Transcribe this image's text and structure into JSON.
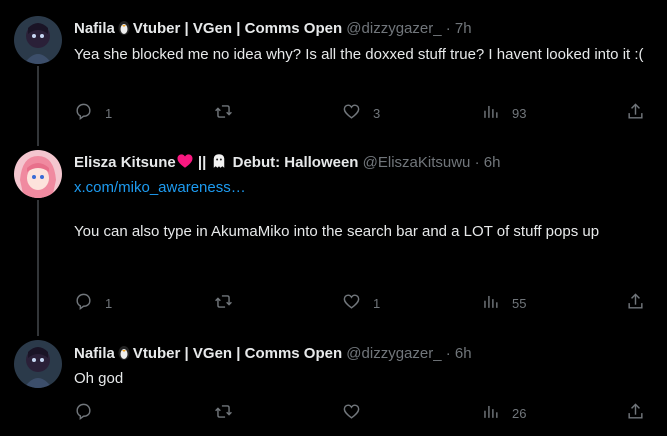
{
  "tweets": [
    {
      "name": "Nafila",
      "name_emoji": "penguin",
      "name_rest": "Vtuber | VGen | Comms Open",
      "handle": "@dizzygazer_",
      "sep": "·",
      "time": "7h",
      "text": "Yea she blocked me no idea why? Is all the doxxed stuff true? I havent looked into it :(",
      "stats": {
        "replies": "1",
        "retweets": "",
        "likes": "3",
        "views": "93"
      }
    },
    {
      "name": "Elisza Kitsune",
      "name_emoji": "heart",
      "name_rest": "|| ",
      "name_rest2": "Debut: Halloween",
      "handle": "@EliszaKitsuwu",
      "sep": "·",
      "time": "6h",
      "link": "x.com/miko_awareness…",
      "text": "You can also type in AkumaMiko into the search bar and a LOT of stuff pops up",
      "stats": {
        "replies": "1",
        "retweets": "",
        "likes": "1",
        "views": "55"
      }
    },
    {
      "name": "Nafila",
      "name_emoji": "penguin",
      "name_rest": "Vtuber | VGen | Comms Open",
      "handle": "@dizzygazer_",
      "sep": "·",
      "time": "6h",
      "text": "Oh god",
      "stats": {
        "replies": "",
        "retweets": "",
        "likes": "",
        "views": "26"
      }
    }
  ],
  "colors": {
    "bg": "#000000",
    "text": "#e7e9ea",
    "muted": "#71767b",
    "link": "#1d9bf0",
    "heart": "#f91880"
  }
}
